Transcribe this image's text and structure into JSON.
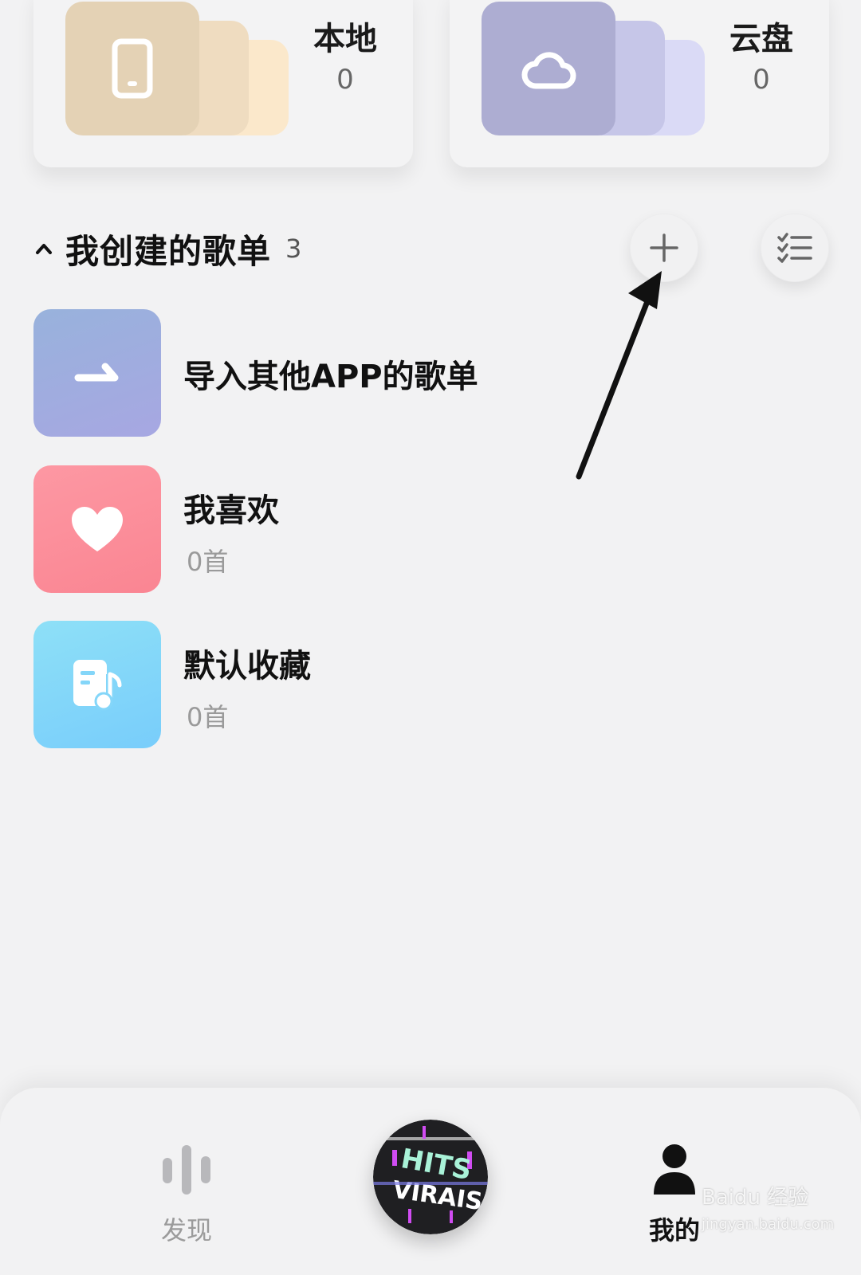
{
  "storage": {
    "local": {
      "title": "本地",
      "count": "0",
      "icon": "phone-icon"
    },
    "cloud": {
      "title": "云盘",
      "count": "0",
      "icon": "cloud-icon"
    }
  },
  "section": {
    "title": "我创建的歌单",
    "count": "3",
    "collapse_icon": "chevron-up-icon",
    "add_icon": "plus-icon",
    "manage_icon": "checklist-icon"
  },
  "playlists": [
    {
      "title": "导入其他APP的歌单",
      "subtitle": "",
      "icon": "import-arrow-icon"
    },
    {
      "title": "我喜欢",
      "subtitle": "0首",
      "icon": "heart-icon"
    },
    {
      "title": "默认收藏",
      "subtitle": "0首",
      "icon": "music-note-doc-icon"
    }
  ],
  "nav": {
    "discover_label": "发现",
    "mine_label": "我的",
    "player_art_text": "HITS VIRAIS"
  },
  "watermark": {
    "text": "Baidu 经验",
    "subtext": "jingyan.baidu.com"
  },
  "colors": {
    "background": "#f2f2f3",
    "local_tile": "#e4d2b5",
    "cloud_tile": "#adadd2",
    "import_tile": "#a2ade0",
    "liked_tile": "#fc8e9a",
    "default_tile": "#84d6f9"
  }
}
